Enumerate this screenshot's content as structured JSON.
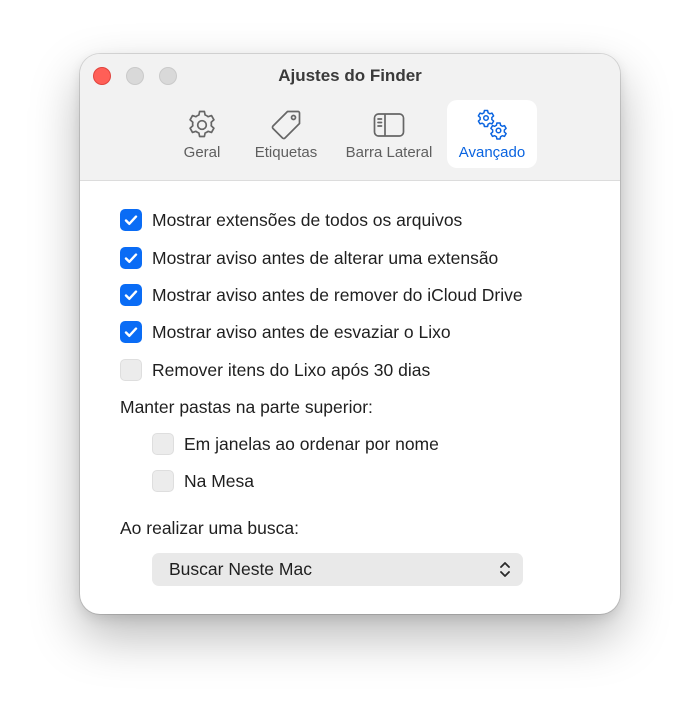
{
  "window": {
    "title": "Ajustes do Finder"
  },
  "tabs": [
    {
      "label": "Geral",
      "icon": "gear-icon",
      "active": false
    },
    {
      "label": "Etiquetas",
      "icon": "tag-icon",
      "active": false
    },
    {
      "label": "Barra Lateral",
      "icon": "sidebar-icon",
      "active": false
    },
    {
      "label": "Avançado",
      "icon": "gears-icon",
      "active": true
    }
  ],
  "options": [
    {
      "label": "Mostrar extensões de todos os arquivos",
      "checked": true
    },
    {
      "label": "Mostrar aviso antes de alterar uma extensão",
      "checked": true
    },
    {
      "label": "Mostrar aviso antes de remover do iCloud Drive",
      "checked": true
    },
    {
      "label": "Mostrar aviso antes de esvaziar o Lixo",
      "checked": true
    },
    {
      "label": "Remover itens do Lixo após 30 dias",
      "checked": false
    }
  ],
  "folders_section": {
    "label": "Manter pastas na parte superior:",
    "options": [
      {
        "label": "Em janelas ao ordenar por nome",
        "checked": false
      },
      {
        "label": "Na Mesa",
        "checked": false
      }
    ]
  },
  "search_section": {
    "label": "Ao realizar uma busca:",
    "selected": "Buscar Neste Mac"
  },
  "colors": {
    "accent": "#0a6cf5",
    "close_button": "#ff5f57",
    "inactive_button": "#d9d9d9",
    "titlebar": "#f2f2f2"
  }
}
